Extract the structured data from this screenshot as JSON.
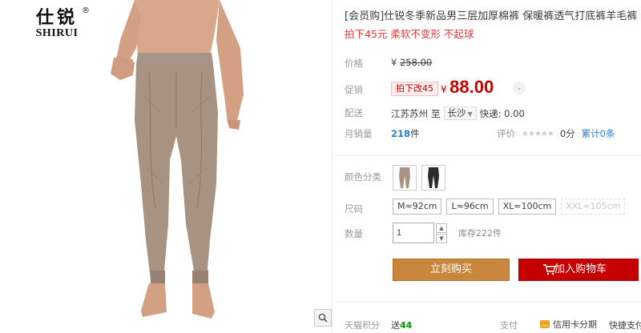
{
  "brand": {
    "cn": "仕锐",
    "en": "SHIRUI",
    "reg": "®"
  },
  "product": {
    "title": "[会员购]仕锐冬季新品男三层加厚棉裤 保暖裤透气打底裤羊毛裤",
    "subtitle": "拍下45元 柔软不变形 不起球"
  },
  "price": {
    "label": "价格",
    "currency": "¥",
    "original": "258.00",
    "promo_label": "促销",
    "promo_tag": "拍下改45",
    "promo_value": "88.00"
  },
  "shipping": {
    "label": "配送",
    "from": "江苏苏州",
    "to_word": "至",
    "city": "长沙",
    "express": "快递: 0.00"
  },
  "sales": {
    "label": "月销量",
    "count": "218",
    "unit": "件",
    "rating_label": "评价",
    "stars": "★★★★★",
    "rating_count": "0分",
    "cumulative": "累计0条"
  },
  "options": {
    "color_label": "颜色分类",
    "colors": [
      {
        "name": "camel",
        "color": "#a89282"
      },
      {
        "name": "black",
        "color": "#2b2b2b"
      }
    ],
    "size_label": "尺码",
    "sizes": [
      "M≈92cm",
      "L≈96cm",
      "XL≈100cm",
      "XXL≈105cm"
    ],
    "qty_label": "数量",
    "qty": "1",
    "stock": "库存222件"
  },
  "actions": {
    "buy": "立刻购买",
    "cart": "加入购物车"
  },
  "footer": {
    "points_label": "天猫积分",
    "points_prefix": "送",
    "points_value": "44",
    "pay_label": "支付",
    "card": "信用卡分期",
    "fast": "快捷支付"
  },
  "colors": {
    "accent": "#c40000",
    "buy": "#c8873c",
    "link": "#2a7ed6"
  }
}
